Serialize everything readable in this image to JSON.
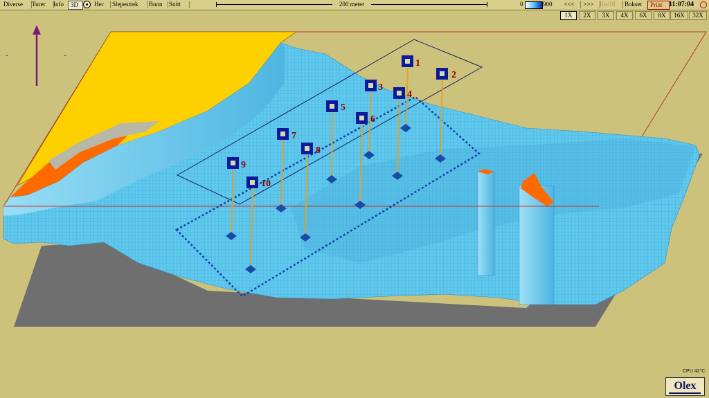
{
  "toolbar": {
    "items": [
      "Diverse",
      "Turer",
      "Info",
      "3D",
      "Her",
      "Slepestrek",
      "Bunn",
      "Snitt"
    ],
    "scale_label": "200 meter",
    "depth_min": "0",
    "depth_max": "900",
    "reduced_label": "Redfff",
    "boxes_label": "Bokser",
    "print_label": "Print",
    "clock": "11:07:04"
  },
  "zoom": {
    "pan_left": "<<<",
    "pan_right": ">>>",
    "levels": [
      "1X",
      "2X",
      "3X",
      "4X",
      "6X",
      "8X",
      "16X",
      "32X"
    ],
    "selected": "1X"
  },
  "map": {
    "north_indicator": "north-arrow",
    "side_marks": [
      "-",
      "-"
    ],
    "waypoints": [
      "1",
      "2",
      "3",
      "4",
      "5",
      "6",
      "7",
      "8",
      "9",
      "10"
    ],
    "colors": {
      "seabed": "#5fc8ec",
      "land": "#ffd000",
      "shore": "#ff6a00",
      "base": "#7a7a7a",
      "waypoint": "#0a1a9a"
    }
  },
  "status": {
    "cpu": "CPU 42°C",
    "brand": "Olex"
  }
}
